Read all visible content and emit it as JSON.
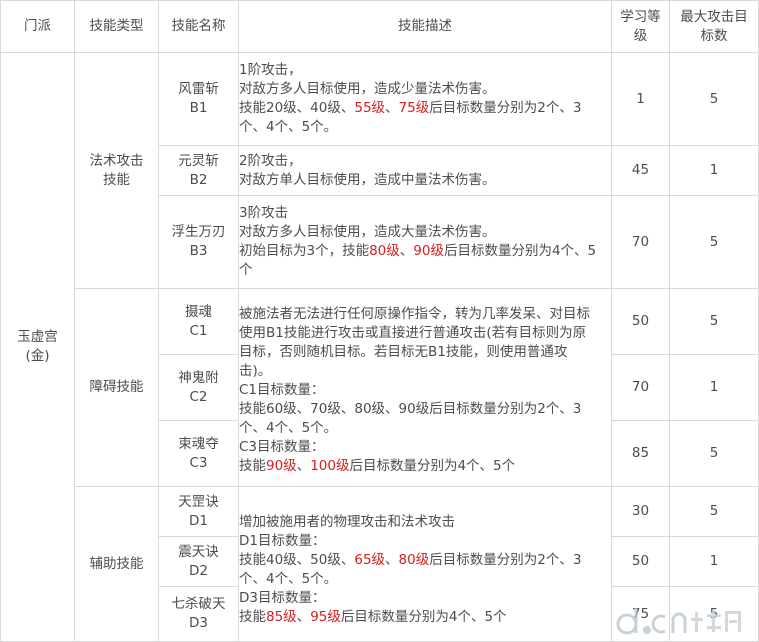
{
  "headers": {
    "sect": "门派",
    "skill_type": "技能类型",
    "skill_name": "技能名称",
    "skill_desc": "技能描述",
    "learn_level": "学习等级",
    "max_targets": "最大攻击目标数"
  },
  "sect": "玉虚宫(金)",
  "sect_lines": [
    "玉虚宫",
    "(金)"
  ],
  "groups": [
    {
      "type_lines": [
        "法术攻击",
        "技能"
      ]
    },
    {
      "type_lines": [
        "障碍技能"
      ]
    },
    {
      "type_lines": [
        "辅助技能"
      ]
    }
  ],
  "skills": [
    {
      "name": "风雷斩",
      "code": "B1",
      "level": "1",
      "targets": "5"
    },
    {
      "name": "元灵斩",
      "code": "B2",
      "level": "45",
      "targets": "1"
    },
    {
      "name": "浮生万刃",
      "code": "B3",
      "level": "70",
      "targets": "5"
    },
    {
      "name": "摄魂",
      "code": "C1",
      "level": "50",
      "targets": "5"
    },
    {
      "name": "神鬼附",
      "code": "C2",
      "level": "70",
      "targets": "1"
    },
    {
      "name": "束魂夺",
      "code": "C3",
      "level": "85",
      "targets": "5"
    },
    {
      "name": "天罡诀",
      "code": "D1",
      "level": "30",
      "targets": "5"
    },
    {
      "name": "震天诀",
      "code": "D2",
      "level": "50",
      "targets": "1"
    },
    {
      "name": "七杀破天",
      "code": "D3",
      "level": "75",
      "targets": "5"
    }
  ],
  "descriptions": {
    "b1": {
      "l1": "1阶攻击，",
      "l2": "对敌方多人目标使用，造成少量法术伤害。",
      "l3a": "技能20级、40级、",
      "l3r1": "55级",
      "l3b": "、",
      "l3r2": "75级",
      "l3c": "后目标数量分别为2个、3",
      "l4": "个、4个、5个。"
    },
    "b2": {
      "l1": "2阶攻击，",
      "l2": "对敌方单人目标使用，造成中量法术伤害。"
    },
    "b3": {
      "l1": "3阶攻击",
      "l2": "对敌方多人目标使用，造成大量法术伤害。",
      "l3a": "初始目标为3个，技能",
      "l3r1": "80级",
      "l3b": "、",
      "l3r2": "90级",
      "l3c": "后目标数量分别为4个、5",
      "l4": "个"
    },
    "c": {
      "l1": "被施法者无法进行任何原操作指令，转为几率发呆、对目标",
      "l2": "使用B1技能进行攻击或直接进行普通攻击(若有目标则为原",
      "l3": "目标，否则随机目标。若目标无B1技能，则使用普通攻",
      "l4": "击)。",
      "l5": "C1目标数量：",
      "l6": "技能60级、70级、80级、90级后目标数量分别为2个、3",
      "l7": "个、4个、5个。",
      "l8": "C3目标数量：",
      "l9a": "技能",
      "l9r1": "90级",
      "l9b": "、",
      "l9r2": "100级",
      "l9c": "后目标数量分别为4个、5个"
    },
    "d": {
      "l1": "增加被施用者的物理攻击和法术攻击",
      "l2": "D1目标数量：",
      "l3a": "技能40级、50级、",
      "l3r1": "65级",
      "l3b": "、",
      "l3r2": "80级",
      "l3c": "后目标数量分别为2个、3",
      "l4": "个、4个、5个。",
      "l5": "D3目标数量：",
      "l6a": "技能",
      "l6r1": "85级",
      "l6b": "、",
      "l6r2": "95级",
      "l6c": "后目标数量分别为4个、5个"
    }
  },
  "watermark": "d.cn 当乐网",
  "colors": {
    "highlight": "#d42020",
    "border": "#d9d9d9",
    "text": "#4d4d4d"
  }
}
